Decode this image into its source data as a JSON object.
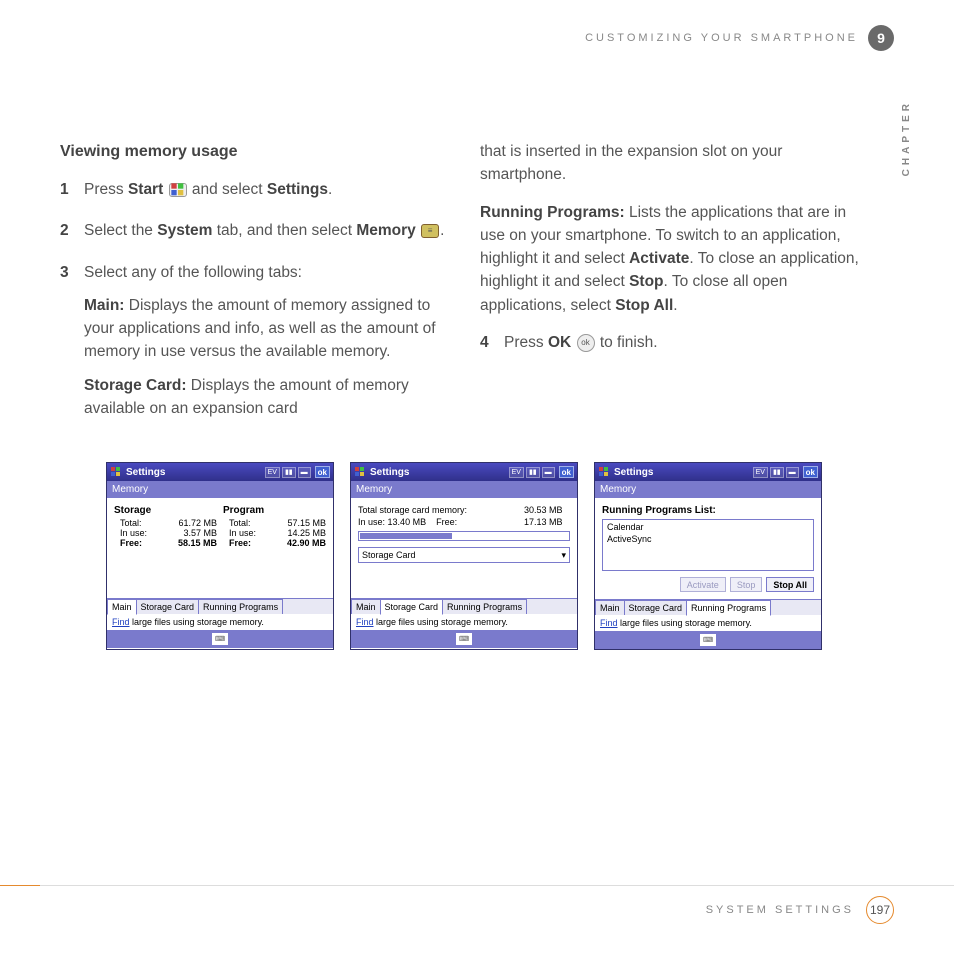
{
  "header": {
    "section_title": "CUSTOMIZING YOUR SMARTPHONE",
    "chapter_number": "9",
    "chapter_label": "CHAPTER"
  },
  "body": {
    "heading": "Viewing memory usage",
    "step1_a": "Press ",
    "step1_start": "Start",
    "step1_b": " and select ",
    "step1_settings": "Settings",
    "step1_c": ".",
    "step2_a": "Select the ",
    "step2_system": "System",
    "step2_b": " tab, and then select ",
    "step2_memory": "Memory",
    "step2_c": ".",
    "step3": "Select any of the following tabs:",
    "main_label": "Main:",
    "main_text": " Displays the amount of memory assigned to your applications and info, as well as the amount of memory in use versus the available memory.",
    "storage_label": "Storage Card:",
    "storage_text": " Displays the amount of memory available on an expansion card",
    "col2_p1": "that is inserted in the expansion slot on your smartphone.",
    "running_label": "Running Programs:",
    "running_text_a": " Lists the applications that are in use on your smartphone. To switch to an application, highlight it and select ",
    "running_activate": "Activate",
    "running_text_b": ". To close an application, highlight it and select ",
    "running_stop": "Stop",
    "running_text_c": ". To close all open applications, select ",
    "running_stopall": "Stop All",
    "running_text_d": ".",
    "step4_a": "Press ",
    "step4_ok": "OK",
    "step4_b": " to finish."
  },
  "shots": {
    "titlebar_title": "Settings",
    "ev": "EV",
    "ok": "ok",
    "subheader": "Memory",
    "s1": {
      "storage_h": "Storage",
      "program_h": "Program",
      "total_l": "Total:",
      "inuse_l": "In use:",
      "free_l": "Free:",
      "s_total": "61.72 MB",
      "s_inuse": "3.57 MB",
      "s_free": "58.15 MB",
      "p_total": "57.15 MB",
      "p_inuse": "14.25 MB",
      "p_free": "42.90 MB"
    },
    "s2": {
      "k1": "Total storage card memory:",
      "v1": "30.53 MB",
      "k2": "In use:",
      "v2": "13.40 MB",
      "k3": "Free:",
      "v3": "17.13 MB",
      "combo": "Storage Card",
      "progress_pct": 44
    },
    "s3": {
      "list_label": "Running Programs List:",
      "items": [
        "Calendar",
        "ActiveSync"
      ],
      "btn_activate": "Activate",
      "btn_stop": "Stop",
      "btn_stopall": "Stop All"
    },
    "tabs": {
      "main": "Main",
      "storage": "Storage Card",
      "running": "Running Programs"
    },
    "find_link": "Find",
    "find_text": " large files using storage memory."
  },
  "footer": {
    "section": "SYSTEM SETTINGS",
    "page": "197"
  }
}
